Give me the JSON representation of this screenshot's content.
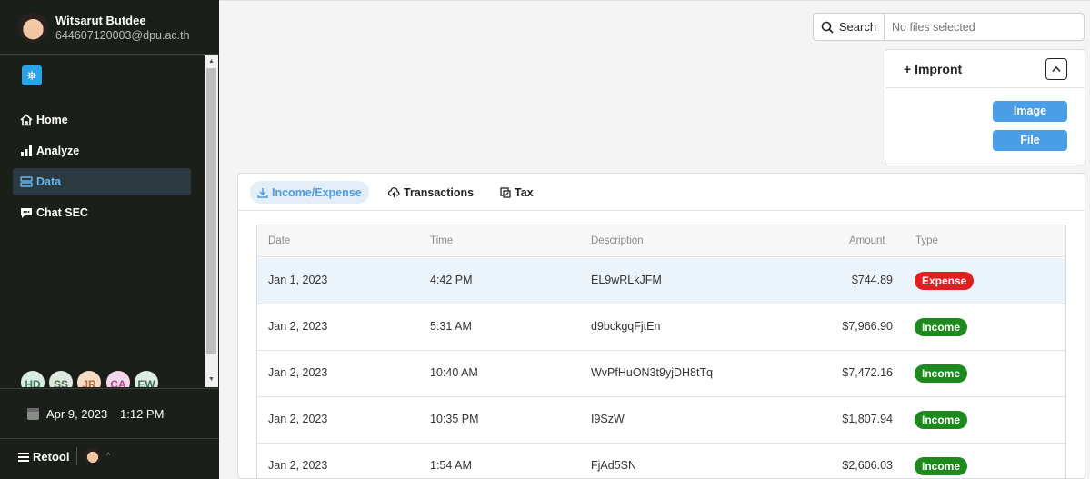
{
  "user": {
    "name": "Witsarut Butdee",
    "email": "644607120003@dpu.ac.th"
  },
  "nav": [
    {
      "label": "Home",
      "icon": "home-icon"
    },
    {
      "label": "Analyze",
      "icon": "bar-chart-icon"
    },
    {
      "label": "Data",
      "icon": "database-icon",
      "active": true
    },
    {
      "label": "Chat SEC",
      "icon": "chat-icon"
    }
  ],
  "presence_avatars": [
    {
      "initials": "HD",
      "color": "#d6ece0",
      "text": "#3a7a55"
    },
    {
      "initials": "SS",
      "color": "#dde7dd",
      "text": "#4a6a4a"
    },
    {
      "initials": "JR",
      "color": "#f6dcc6",
      "text": "#b06a3a"
    },
    {
      "initials": "CA",
      "color": "#f6d6ea",
      "text": "#b04a8a"
    },
    {
      "initials": "EW",
      "color": "#dcece4",
      "text": "#3a6a55"
    }
  ],
  "datetime": {
    "date": "Apr 9, 2023",
    "time": "1:12 PM"
  },
  "footer": {
    "brand": "Retool"
  },
  "search": {
    "button_label": "Search",
    "placeholder": "No files selected"
  },
  "import_card": {
    "title": "+ Impront",
    "image_button": "Image",
    "file_button": "File"
  },
  "tabs": [
    {
      "label": "Income/Expense",
      "active": true
    },
    {
      "label": "Transactions"
    },
    {
      "label": "Tax"
    }
  ],
  "table": {
    "columns": [
      "Date",
      "Time",
      "Description",
      "Amount",
      "Type"
    ],
    "rows": [
      {
        "date": "Jan 1, 2023",
        "time": "4:42 PM",
        "description": "EL9wRLkJFM",
        "amount": "$744.89",
        "type": "Expense"
      },
      {
        "date": "Jan 2, 2023",
        "time": "5:31 AM",
        "description": "d9bckgqFjtEn",
        "amount": "$7,966.90",
        "type": "Income"
      },
      {
        "date": "Jan 2, 2023",
        "time": "10:40 AM",
        "description": "WvPfHuON3t9yjDH8tTq",
        "amount": "$7,472.16",
        "type": "Income"
      },
      {
        "date": "Jan 2, 2023",
        "time": "10:35 PM",
        "description": "I9SzW",
        "amount": "$1,807.94",
        "type": "Income"
      },
      {
        "date": "Jan 2, 2023",
        "time": "1:54 AM",
        "description": "FjAd5SN",
        "amount": "$2,606.03",
        "type": "Income"
      }
    ]
  }
}
